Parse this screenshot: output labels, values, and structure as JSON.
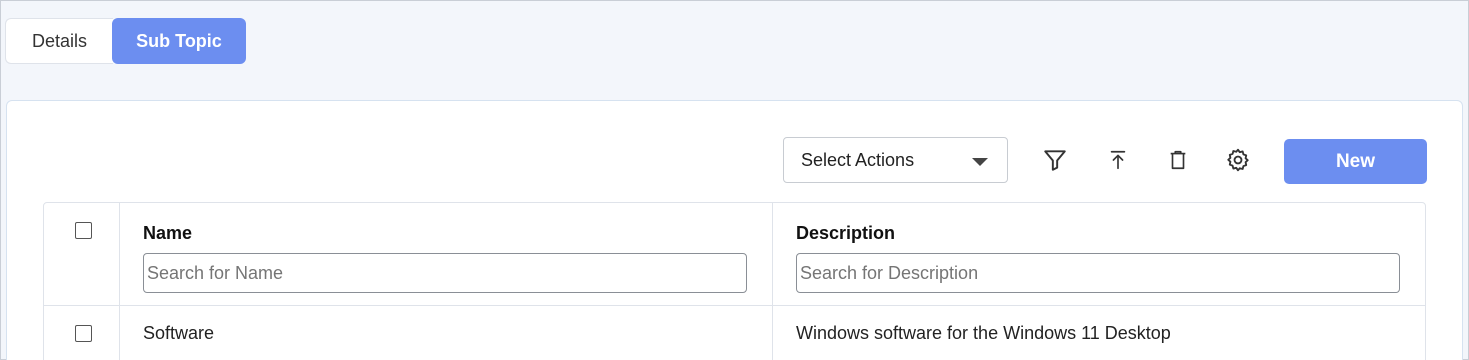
{
  "tabs": [
    {
      "label": "Details",
      "active": false
    },
    {
      "label": "Sub Topic",
      "active": true
    }
  ],
  "toolbar": {
    "select_actions": "Select Actions",
    "icons": [
      "filter-icon",
      "upload-icon",
      "trash-icon",
      "gear-icon"
    ],
    "new_label": "New"
  },
  "table": {
    "columns": [
      {
        "label": "Name",
        "placeholder": "Search for Name"
      },
      {
        "label": "Description",
        "placeholder": "Search for Description"
      }
    ],
    "rows": [
      {
        "name": "Software",
        "description": "Windows software for the Windows 11 Desktop"
      }
    ]
  },
  "colors": {
    "accent": "#6c8ef0",
    "background": "#f3f6fb"
  }
}
